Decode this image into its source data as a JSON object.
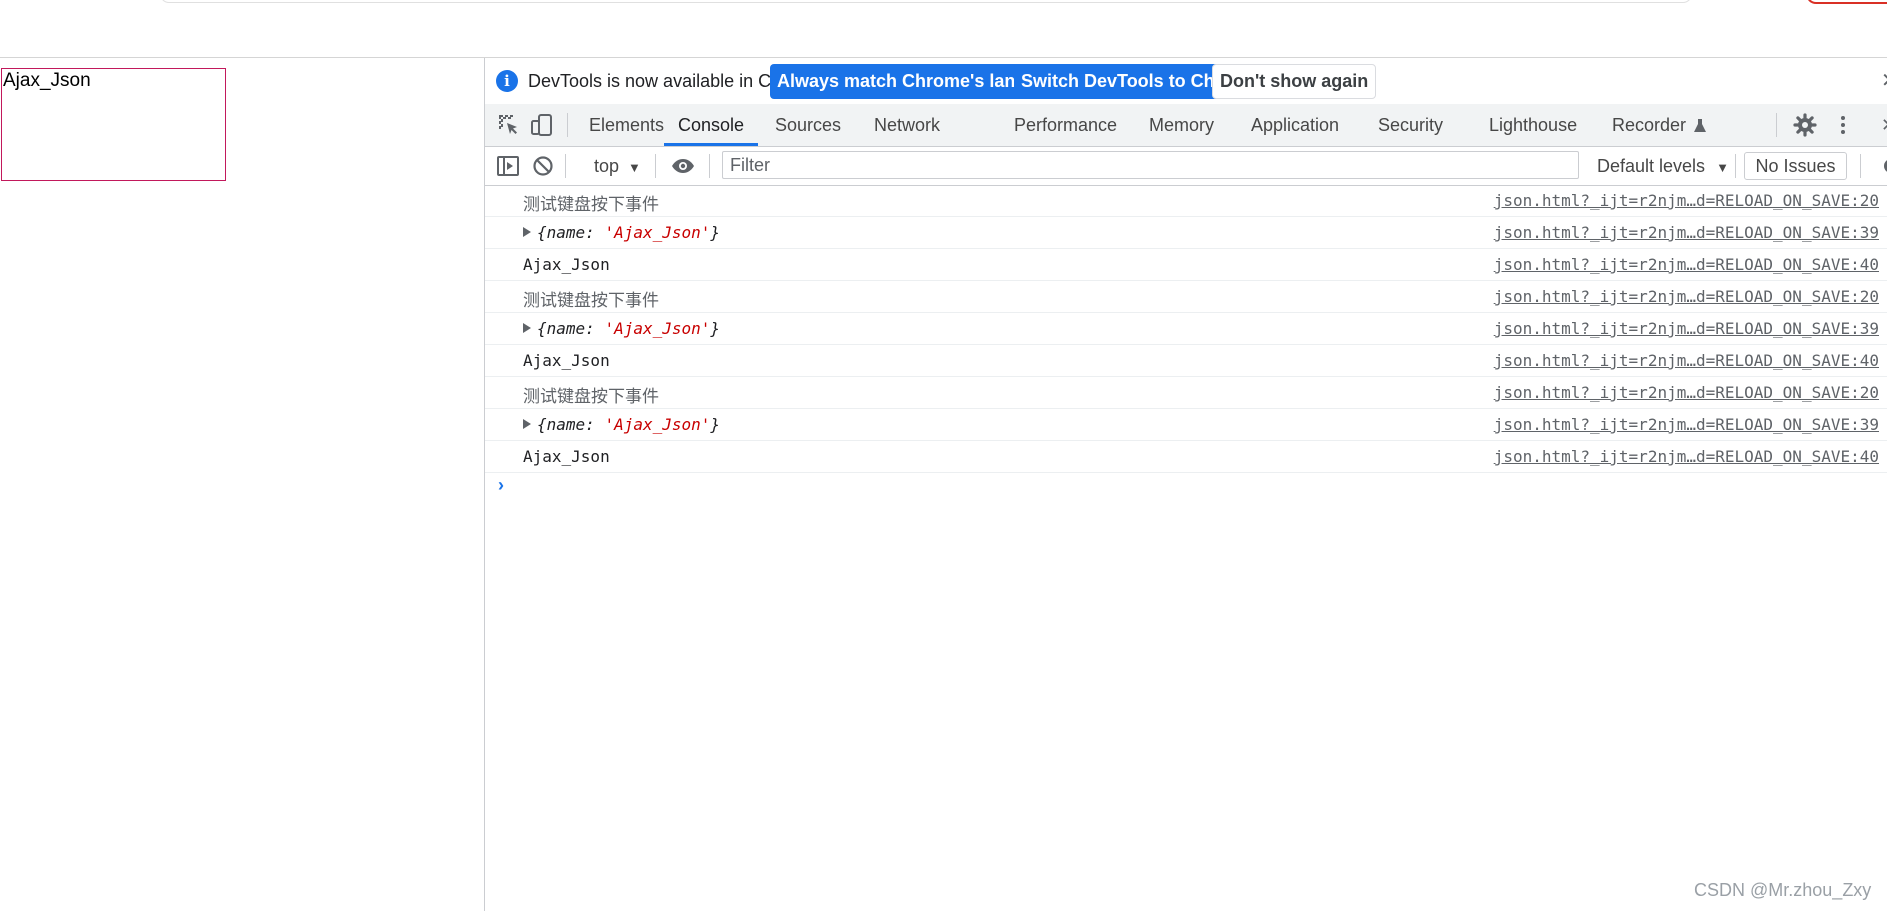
{
  "page": {
    "box_text": "Ajax_Json"
  },
  "infobar": {
    "message": "DevTools is now available in Chinese!",
    "btn_match": "Always match Chrome's language",
    "btn_switch": "Switch DevTools to Chinese",
    "btn_dismiss": "Don't show again",
    "close": "✕"
  },
  "tabs": [
    "Elements",
    "Console",
    "Sources",
    "Network",
    "Performance",
    "Memory",
    "Application",
    "Security",
    "Lighthouse",
    "Recorder"
  ],
  "toolbar": {
    "context": "top",
    "filter_placeholder": "Filter",
    "levels": "Default levels",
    "issues": "No Issues"
  },
  "console": {
    "rows": [
      {
        "kind": "text-cjk",
        "text": "测试键盘按下事件",
        "source": "json.html?_ijt=r2njm…d=RELOAD_ON_SAVE:20"
      },
      {
        "kind": "object",
        "key": "name",
        "value": "'Ajax_Json'",
        "source": "json.html?_ijt=r2njm…d=RELOAD_ON_SAVE:39"
      },
      {
        "kind": "text",
        "text": "Ajax_Json",
        "source": "json.html?_ijt=r2njm…d=RELOAD_ON_SAVE:40"
      },
      {
        "kind": "text-cjk",
        "text": "测试键盘按下事件",
        "source": "json.html?_ijt=r2njm…d=RELOAD_ON_SAVE:20"
      },
      {
        "kind": "object",
        "key": "name",
        "value": "'Ajax_Json'",
        "source": "json.html?_ijt=r2njm…d=RELOAD_ON_SAVE:39"
      },
      {
        "kind": "text",
        "text": "Ajax_Json",
        "source": "json.html?_ijt=r2njm…d=RELOAD_ON_SAVE:40"
      },
      {
        "kind": "text-cjk",
        "text": "测试键盘按下事件",
        "source": "json.html?_ijt=r2njm…d=RELOAD_ON_SAVE:20"
      },
      {
        "kind": "object",
        "key": "name",
        "value": "'Ajax_Json'",
        "source": "json.html?_ijt=r2njm…d=RELOAD_ON_SAVE:39"
      },
      {
        "kind": "text",
        "text": "Ajax_Json",
        "source": "json.html?_ijt=r2njm…d=RELOAD_ON_SAVE:40"
      }
    ],
    "prompt": "›"
  },
  "watermark": "CSDN @Mr.zhou_Zxy",
  "colors": {
    "accent": "#1a73e8",
    "string": "#c80000",
    "page_box_border": "#c2185b"
  },
  "icons": [
    "inspect-element-icon",
    "device-toolbar-icon",
    "recorder-flask-icon",
    "settings-gear-icon",
    "kebab-menu-icon",
    "sidebar-toggle-icon",
    "clear-console-icon",
    "live-expression-eye-icon"
  ]
}
